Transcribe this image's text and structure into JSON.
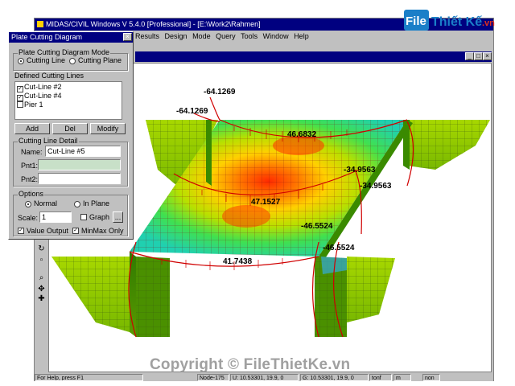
{
  "app": {
    "title": "MIDAS/CIVIL Windows V 5.4.0 [Professional] - [E:\\Work2\\Rahmen]",
    "menu": [
      "Results",
      "Design",
      "Mode",
      "Query",
      "Tools",
      "Window",
      "Help"
    ]
  },
  "logo": {
    "file": "File",
    "brand": "Thiết Kế",
    "tld": ".vn"
  },
  "watermark": "Copyright © FileThietKe.vn",
  "dialog": {
    "title": "Plate Cutting Diagram",
    "mode_group": "Plate Cutting Diagram Mode",
    "mode_options": [
      "Cutting Line",
      "Cutting Plane"
    ],
    "defined_label": "Defined Cutting Lines",
    "cutting_lines": [
      {
        "name": "Cut-Line #2",
        "checked": true
      },
      {
        "name": "Cut-Line #4",
        "checked": true
      },
      {
        "name": "Pier 1",
        "checked": false
      }
    ],
    "buttons": {
      "add": "Add",
      "del": "Del",
      "modify": "Modify"
    },
    "detail_group": "Cutting Line Detail",
    "name_label": "Name:",
    "name_value": "Cut-Line #5",
    "pnt1_label": "Pnt1:",
    "pnt2_label": "Pnt2:",
    "options_group": "Options",
    "options_radios": [
      "Normal",
      "In Plane"
    ],
    "scale_label": "Scale:",
    "scale_value": "1",
    "graph_label": "Graph",
    "graph_button": "...",
    "value_output": "Value Output",
    "minmax_only": "MinMax Only"
  },
  "values": {
    "v1": "-64.1269",
    "v2": "-64.1269",
    "v3": "46.6832",
    "v4": "-34.9563",
    "v5": "-34.9563",
    "v6": "47.1527",
    "v7": "-46.5524",
    "v8": "-46.5524",
    "v9": "41.7438"
  },
  "status": {
    "help": "For Help, press F1",
    "node": "Node-175",
    "u": "U: 10.53301, 19.9, 0",
    "g": "G: 10.53301, 19.9, 0",
    "unit1": "tonf",
    "unit2": "m",
    "unit3": "non"
  }
}
